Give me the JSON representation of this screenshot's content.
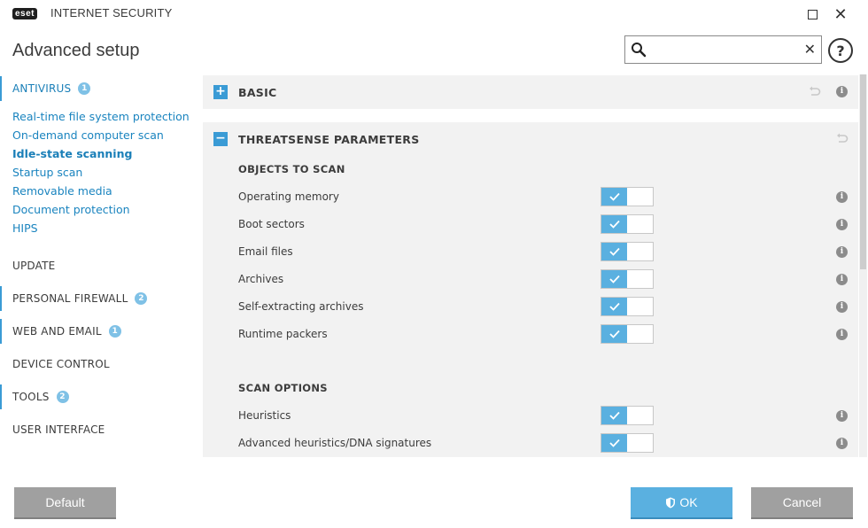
{
  "window": {
    "logo_text": "eset",
    "app_name": "INTERNET SECURITY",
    "maximize_icon": "maximize-icon",
    "close_icon": "close-icon"
  },
  "header": {
    "title": "Advanced setup",
    "search_value": "",
    "help_label": "?"
  },
  "sidebar": {
    "sections": [
      {
        "label": "ANTIVIRUS",
        "badge": "1"
      },
      {
        "label": "UPDATE",
        "badge": ""
      },
      {
        "label": "PERSONAL FIREWALL",
        "badge": "2"
      },
      {
        "label": "WEB AND EMAIL",
        "badge": "1"
      },
      {
        "label": "DEVICE CONTROL",
        "badge": ""
      },
      {
        "label": "TOOLS",
        "badge": "2"
      },
      {
        "label": "USER INTERFACE",
        "badge": ""
      }
    ],
    "antivirus_items": [
      "Real-time file system protection",
      "On-demand computer scan",
      "Idle-state scanning",
      "Startup scan",
      "Removable media",
      "Document protection",
      "HIPS"
    ],
    "current_item": "Idle-state scanning"
  },
  "main": {
    "groups": [
      {
        "toggle": "+",
        "title": "BASIC"
      },
      {
        "toggle": "−",
        "title": "THREATSENSE PARAMETERS"
      }
    ],
    "objects_title": "OBJECTS TO SCAN",
    "objects": [
      {
        "label": "Operating memory",
        "enabled": true
      },
      {
        "label": "Boot sectors",
        "enabled": true
      },
      {
        "label": "Email files",
        "enabled": true
      },
      {
        "label": "Archives",
        "enabled": true
      },
      {
        "label": "Self-extracting archives",
        "enabled": true
      },
      {
        "label": "Runtime packers",
        "enabled": true
      }
    ],
    "options_title": "SCAN OPTIONS",
    "options": [
      {
        "label": "Heuristics",
        "enabled": true
      },
      {
        "label": "Advanced heuristics/DNA signatures",
        "enabled": true
      }
    ],
    "info_glyph": "i"
  },
  "footer": {
    "default_label": "Default",
    "ok_label": "OK",
    "cancel_label": "Cancel"
  },
  "colors": {
    "accent": "#3a9bd5",
    "switch_on": "#5ab0e0",
    "link": "#1a84bf",
    "button_gray": "#a0a0a0"
  }
}
